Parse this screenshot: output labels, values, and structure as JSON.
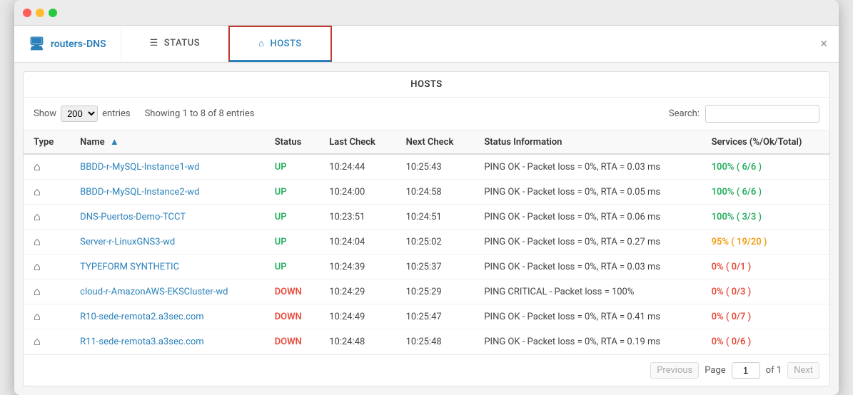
{
  "window": {
    "title": "routers-DNS"
  },
  "nav": {
    "brand": {
      "icon": "🖥",
      "label": "routers-DNS"
    },
    "tabs": [
      {
        "id": "status",
        "icon": "☰",
        "label": "STATUS",
        "active": false
      },
      {
        "id": "hosts",
        "icon": "⌂",
        "label": "HOSTS",
        "active": true
      }
    ],
    "close_label": "×"
  },
  "section_title": "HOSTS",
  "table_controls": {
    "show_label": "Show",
    "entries_label": "entries",
    "show_value": "200",
    "showing_text": "Showing 1 to 8 of 8 entries",
    "search_label": "Search:",
    "search_placeholder": ""
  },
  "columns": [
    {
      "id": "type",
      "label": "Type",
      "sortable": false
    },
    {
      "id": "name",
      "label": "Name",
      "sortable": true
    },
    {
      "id": "status",
      "label": "Status",
      "sortable": false
    },
    {
      "id": "last_check",
      "label": "Last Check",
      "sortable": false
    },
    {
      "id": "next_check",
      "label": "Next Check",
      "sortable": false
    },
    {
      "id": "status_info",
      "label": "Status Information",
      "sortable": false
    },
    {
      "id": "services",
      "label": "Services (%/Ok/Total)",
      "sortable": false
    }
  ],
  "rows": [
    {
      "icon": "home",
      "name": "BBDD-r-MySQL-Instance1-wd",
      "status": "UP",
      "status_class": "up",
      "last_check": "10:24:44",
      "next_check": "10:25:43",
      "status_info": "PING OK - Packet loss = 0%, RTA = 0.03 ms",
      "services": "100% ( 6/6 )",
      "services_class": "100"
    },
    {
      "icon": "home",
      "name": "BBDD-r-MySQL-Instance2-wd",
      "status": "UP",
      "status_class": "up",
      "last_check": "10:24:00",
      "next_check": "10:24:58",
      "status_info": "PING OK - Packet loss = 0%, RTA = 0.05 ms",
      "services": "100% ( 6/6 )",
      "services_class": "100"
    },
    {
      "icon": "home",
      "name": "DNS-Puertos-Demo-TCCT",
      "status": "UP",
      "status_class": "up",
      "last_check": "10:23:51",
      "next_check": "10:24:51",
      "status_info": "PING OK - Packet loss = 0%, RTA = 0.06 ms",
      "services": "100% ( 3/3 )",
      "services_class": "100"
    },
    {
      "icon": "home",
      "name": "Server-r-LinuxGNS3-wd",
      "status": "UP",
      "status_class": "up",
      "last_check": "10:24:04",
      "next_check": "10:25:02",
      "status_info": "PING OK - Packet loss = 0%, RTA = 0.27 ms",
      "services": "95% ( 19/20 )",
      "services_class": "95"
    },
    {
      "icon": "home",
      "name": "TYPEFORM SYNTHETIC",
      "status": "UP",
      "status_class": "up",
      "last_check": "10:24:39",
      "next_check": "10:25:37",
      "status_info": "PING OK - Packet loss = 0%, RTA = 0.03 ms",
      "services": "0% ( 0/1 )",
      "services_class": "0"
    },
    {
      "icon": "home",
      "name": "cloud-r-AmazonAWS-EKSCluster-wd",
      "status": "DOWN",
      "status_class": "down",
      "last_check": "10:24:29",
      "next_check": "10:25:29",
      "status_info": "PING CRITICAL - Packet loss = 100%",
      "services": "0% ( 0/3 )",
      "services_class": "0"
    },
    {
      "icon": "home",
      "name": "R10-sede-remota2.a3sec.com",
      "status": "DOWN",
      "status_class": "down",
      "last_check": "10:24:49",
      "next_check": "10:25:47",
      "status_info": "PING OK - Packet loss = 0%, RTA = 0.41 ms",
      "services": "0% ( 0/7 )",
      "services_class": "0"
    },
    {
      "icon": "home",
      "name": "R11-sede-remota3.a3sec.com",
      "status": "DOWN",
      "status_class": "down",
      "last_check": "10:24:48",
      "next_check": "10:25:48",
      "status_info": "PING OK - Packet loss = 0%, RTA = 0.19 ms",
      "services": "0% ( 0/6 )",
      "services_class": "0"
    }
  ],
  "pagination": {
    "previous_label": "Previous",
    "page_label": "Page",
    "page_value": "1",
    "of_label": "of 1",
    "next_label": "Next"
  }
}
